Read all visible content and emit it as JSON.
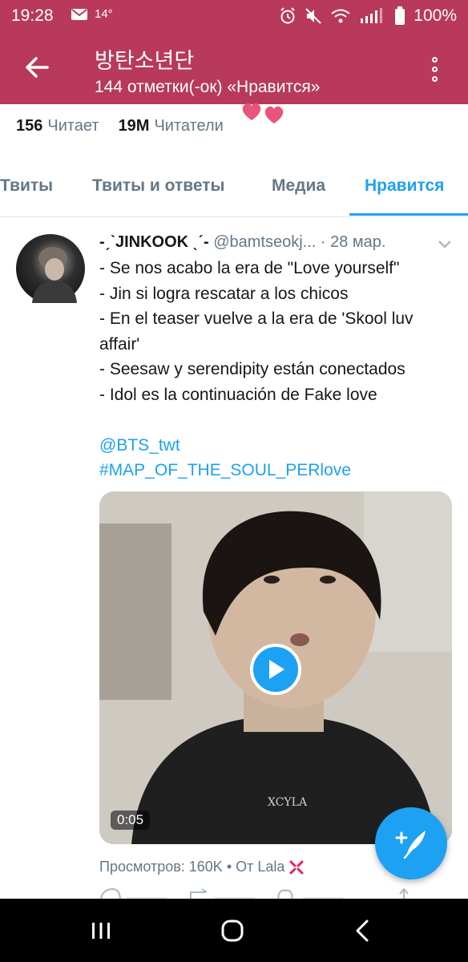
{
  "status_bar": {
    "time": "19:28",
    "temperature": "14°",
    "battery": "100%",
    "icons": [
      "mail-icon",
      "alarm-icon",
      "mute-icon",
      "wifi-icon",
      "signal-icon",
      "battery-icon"
    ]
  },
  "header": {
    "title": "방탄소년단",
    "subtitle": "144 отметки(-ок) «Нравится»",
    "background_color": "#b8395c",
    "back_icon": "arrow-left-icon",
    "menu_icon": "more-vertical-icon"
  },
  "profile_stats": {
    "following_count": "156",
    "following_label": "Читает",
    "followers_count": "19M",
    "followers_label": "Читатели"
  },
  "tabs": [
    {
      "label": "Твиты",
      "active": false
    },
    {
      "label": "Твиты и ответы",
      "active": false
    },
    {
      "label": "Медиа",
      "active": false
    },
    {
      "label": "Нравится",
      "active": true
    }
  ],
  "tweet": {
    "display_name": "-ˏˋJINKOOK ˎˊ-",
    "handle": "@bamtseokj...",
    "date": "· 28 мар.",
    "lines": [
      "- Se nos acabo la era de \"Love yourself\"",
      "- Jin si logra rescatar a los chicos",
      "- En el teaser vuelve a la era de 'Skool luv",
      "affair'",
      "- Seesaw y serendipity están conectados",
      "- Idol es la continuación de Fake love"
    ],
    "mention": "@BTS_twt",
    "hashtag": "#MAP_OF_THE_SOUL_PERlove",
    "video_duration": "0:05",
    "views_text": "Просмотров: 160K • От Lala",
    "angry_emoji": "💢"
  },
  "accent_color": "#1da1f2",
  "fab_icon": "compose-tweet-icon",
  "nav": {
    "recents_icon": "recents-icon",
    "home_icon": "home-icon",
    "back_icon": "back-icon"
  }
}
